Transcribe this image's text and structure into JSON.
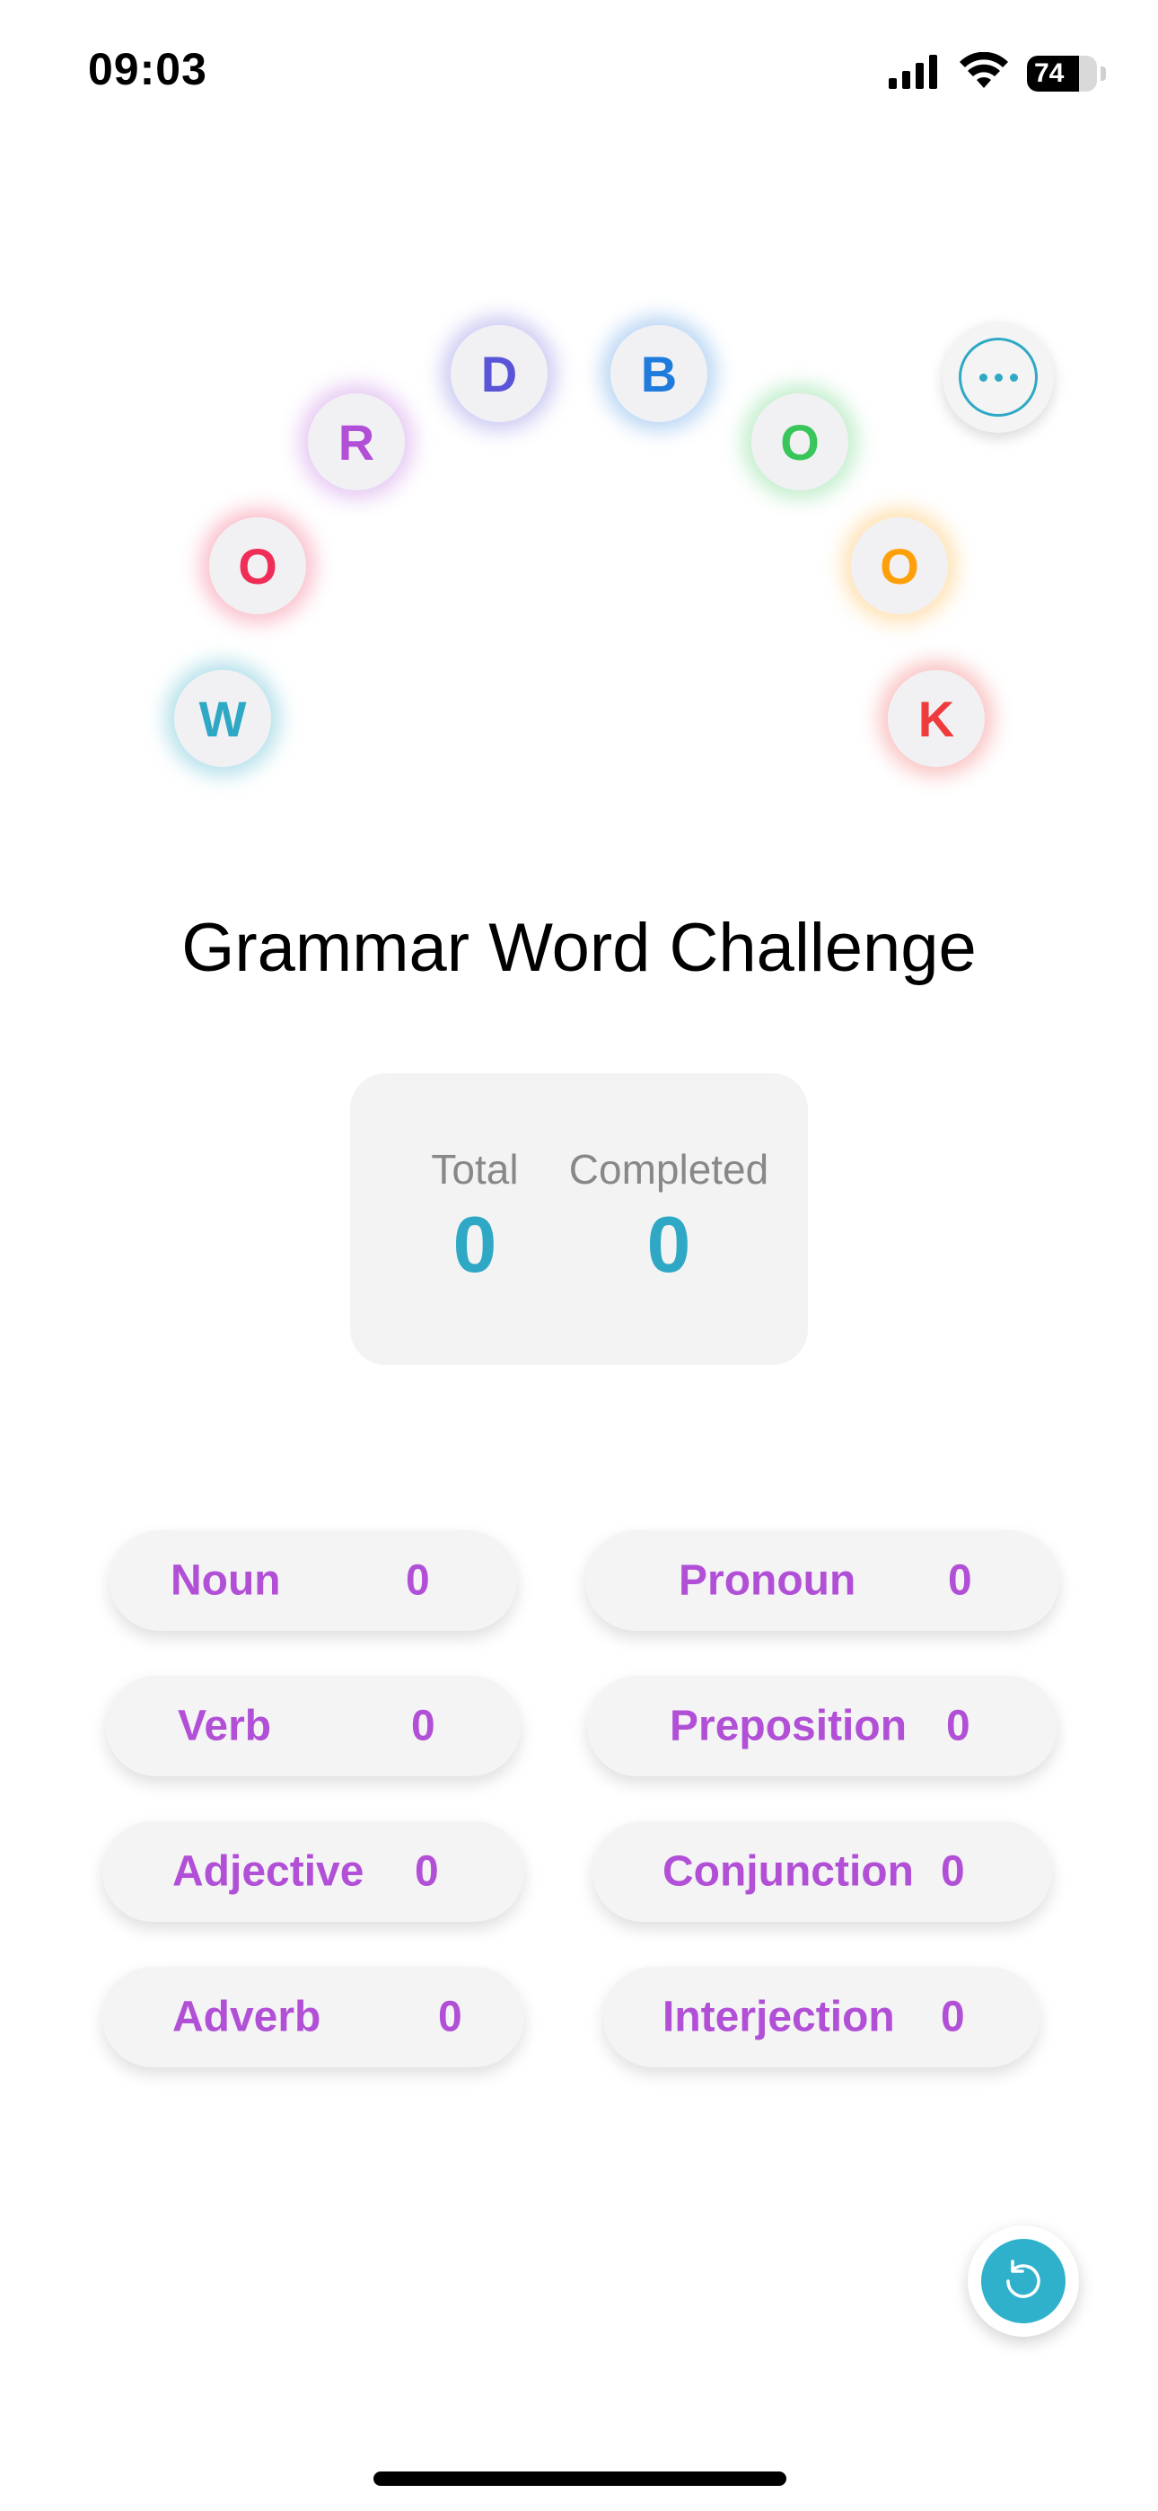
{
  "status_bar": {
    "time": "09:03",
    "battery": "74",
    "battery_fraction": 0.74
  },
  "logo_letters": [
    {
      "char": "W",
      "color": "#2fa8c5",
      "glow": "rgba(47,168,197,0.35)"
    },
    {
      "char": "O",
      "color": "#ef2d56",
      "glow": "rgba(239,45,86,0.30)"
    },
    {
      "char": "R",
      "color": "#b150d6",
      "glow": "rgba(177,80,214,0.30)"
    },
    {
      "char": "D",
      "color": "#5a55d6",
      "glow": "rgba(90,85,214,0.30)"
    },
    {
      "char": "B",
      "color": "#1f7bdc",
      "glow": "rgba(31,123,220,0.30)"
    },
    {
      "char": "O",
      "color": "#38c65a",
      "glow": "rgba(56,198,90,0.30)"
    },
    {
      "char": "O",
      "color": "#ff9f0a",
      "glow": "rgba(255,159,10,0.30)"
    },
    {
      "char": "K",
      "color": "#ef3b3b",
      "glow": "rgba(239,59,59,0.30)"
    }
  ],
  "title": "Grammar Word Challenge",
  "stats": {
    "total_label": "Total",
    "total_value": "0",
    "completed_label": "Completed",
    "completed_value": "0"
  },
  "categories": [
    {
      "label": "Noun",
      "count": "0"
    },
    {
      "label": "Pronoun",
      "count": "0"
    },
    {
      "label": "Verb",
      "count": "0"
    },
    {
      "label": "Preposition",
      "count": "0"
    },
    {
      "label": "Adjective",
      "count": "0"
    },
    {
      "label": "Conjunction",
      "count": "0"
    },
    {
      "label": "Adverb",
      "count": "0"
    },
    {
      "label": "Interjection",
      "count": "0"
    }
  ],
  "colors": {
    "accent": "#2fa8c5",
    "category_text": "#b150d6"
  },
  "icons": {
    "menu": "ellipsis-icon",
    "refresh": "refresh-icon"
  }
}
